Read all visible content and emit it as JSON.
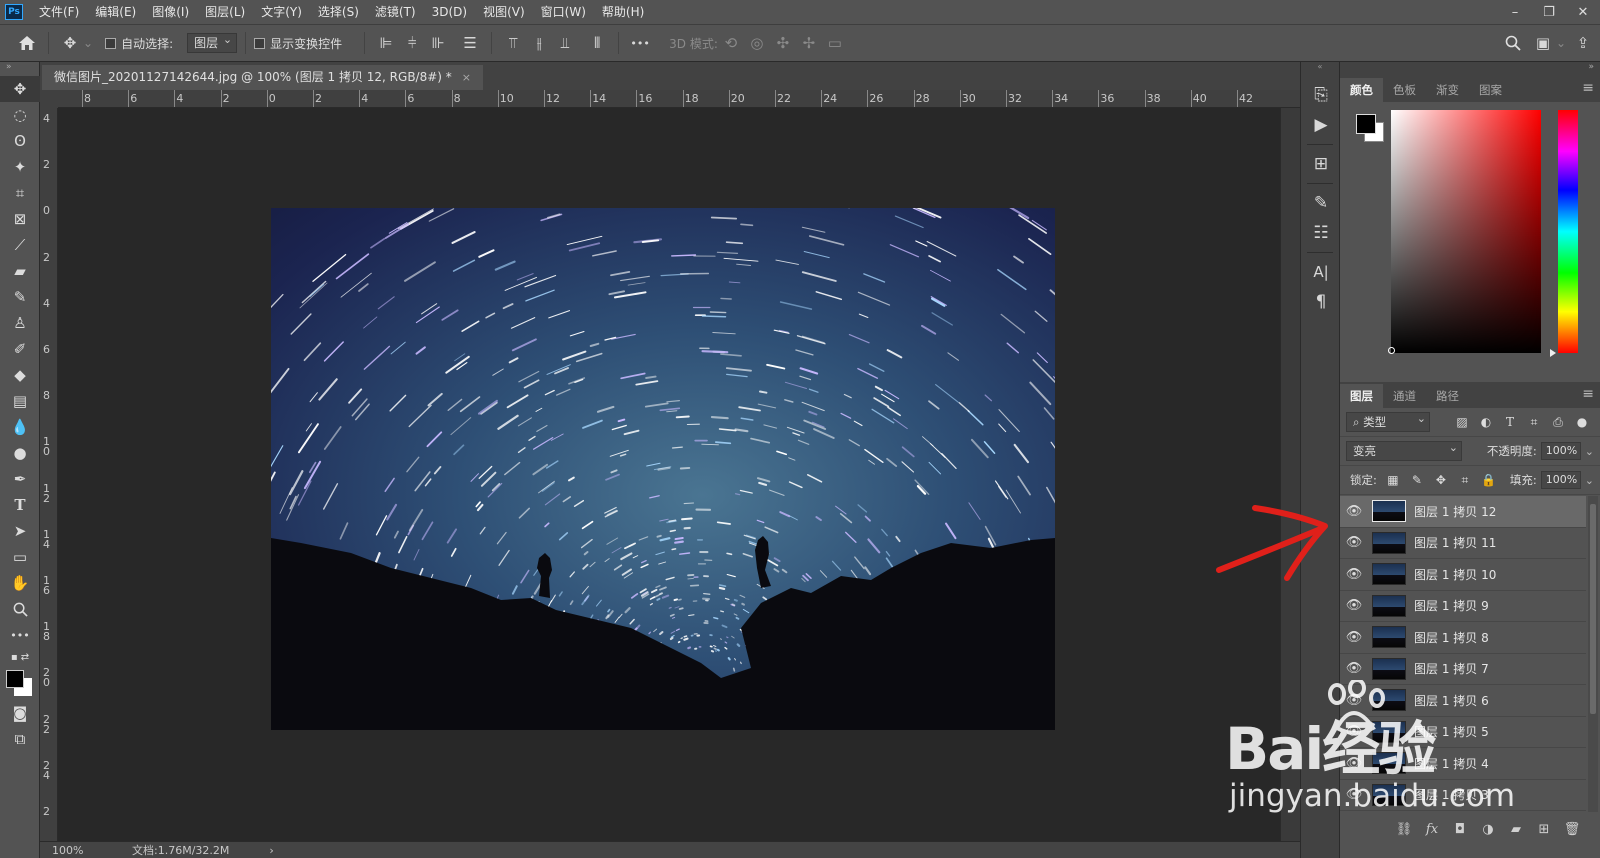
{
  "app": {
    "logo": "Ps",
    "menu": [
      "文件(F)",
      "编辑(E)",
      "图像(I)",
      "图层(L)",
      "文字(Y)",
      "选择(S)",
      "滤镜(T)",
      "3D(D)",
      "视图(V)",
      "窗口(W)",
      "帮助(H)"
    ],
    "window_controls": [
      "–",
      "❐",
      "✕"
    ]
  },
  "options": {
    "auto_select_label": "自动选择:",
    "auto_select_value": "图层",
    "show_transform_label": "显示变换控件",
    "more": "•••",
    "mode_3d_label": "3D 模式:"
  },
  "document": {
    "tab_title": "微信图片_20201127142644.jpg @ 100% (图层 1 拷贝 12, RGB/8#) *",
    "close_glyph": "×",
    "zoom": "100%",
    "doc_info": "文档:1.76M/32.2M",
    "status_arrow": "›"
  },
  "ruler_top_labels": [
    "8",
    "6",
    "4",
    "2",
    "0",
    "2",
    "4",
    "6",
    "8",
    "10",
    "12",
    "14",
    "16",
    "18",
    "20",
    "22",
    "24",
    "26",
    "28",
    "30",
    "32",
    "34",
    "36",
    "38",
    "40",
    "42"
  ],
  "ruler_left_labels": [
    "4",
    "2",
    "0",
    "2",
    "4",
    "6",
    "8",
    "1\n0",
    "1\n2",
    "1\n4",
    "1\n6",
    "1\n8",
    "2\n0",
    "2\n2",
    "2\n4",
    "2"
  ],
  "panels": {
    "color_tabs": [
      "颜色",
      "色板",
      "渐变",
      "图案"
    ],
    "layer_tabs": [
      "图层",
      "通道",
      "路径"
    ],
    "filter_kind": "类型",
    "blend_mode": "变亮",
    "opacity_label": "不透明度:",
    "opacity_value": "100%",
    "lock_label": "锁定:",
    "fill_label": "填充:",
    "fill_value": "100%",
    "foreground_color": "#000000",
    "background_color": "#ffffff"
  },
  "layers": [
    {
      "name": "图层 1 拷贝 12",
      "selected": true
    },
    {
      "name": "图层 1 拷贝 11",
      "selected": false
    },
    {
      "name": "图层 1 拷贝 10",
      "selected": false
    },
    {
      "name": "图层 1 拷贝 9",
      "selected": false
    },
    {
      "name": "图层 1 拷贝 8",
      "selected": false
    },
    {
      "name": "图层 1 拷贝 7",
      "selected": false
    },
    {
      "name": "图层 1 拷贝 6",
      "selected": false
    },
    {
      "name": "图层 1 拷贝 5",
      "selected": false
    },
    {
      "name": "图层 1 拷贝 4",
      "selected": false
    },
    {
      "name": "图层 1 拷贝 3",
      "selected": false
    }
  ],
  "watermark": {
    "brand": "Bai经验",
    "url": "jingyan.baidu.com"
  },
  "annotation": {
    "color": "#e0201a"
  }
}
